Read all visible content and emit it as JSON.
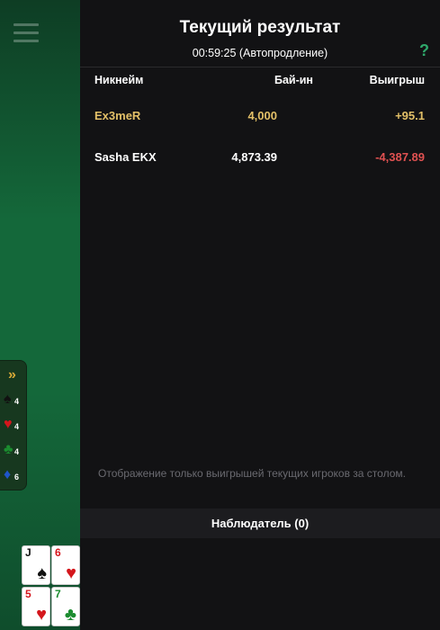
{
  "results": {
    "title": "Текущий результат",
    "subtitle": "00:59:25 (Автопродление)",
    "help_label": "?",
    "columns": {
      "name": "Никнейм",
      "buyin": "Бай-ин",
      "winnings": "Выигрыш"
    },
    "rows": [
      {
        "name": "Ex3meR",
        "buyin": "4,000",
        "winnings": "+95.1",
        "highlight": true
      },
      {
        "name": "Sasha EKX",
        "buyin": "4,873.39",
        "winnings": "-4,387.89",
        "highlight": false
      }
    ],
    "notice": "Отображение только выигрышей текущих игроков за столом.",
    "observer_label": "Наблюдатель  (0)"
  },
  "table": {
    "suit_counter": {
      "chevron": "»",
      "items": [
        {
          "icon": "spade-icon",
          "glyph": "♠",
          "count": "4",
          "color": "#111111"
        },
        {
          "icon": "heart-icon",
          "glyph": "♥",
          "count": "4",
          "color": "#d4161c"
        },
        {
          "icon": "club-icon",
          "glyph": "♣",
          "count": "4",
          "color": "#1b8c2f"
        },
        {
          "icon": "diamond-icon",
          "glyph": "♦",
          "count": "6",
          "color": "#1f55c9"
        }
      ]
    },
    "hand_cards": [
      {
        "rank": "J",
        "suit": "♠",
        "color": "#111111"
      },
      {
        "rank": "6",
        "suit": "♥",
        "color": "#d4161c"
      },
      {
        "rank": "5",
        "suit": "♥",
        "color": "#d4161c"
      },
      {
        "rank": "7",
        "suit": "♣",
        "color": "#1b8c2f"
      }
    ]
  },
  "colors": {
    "accent_gold": "#e3c068",
    "loss_red": "#e05151",
    "help_green": "#2fa86b",
    "felt_green": "#14683a"
  }
}
